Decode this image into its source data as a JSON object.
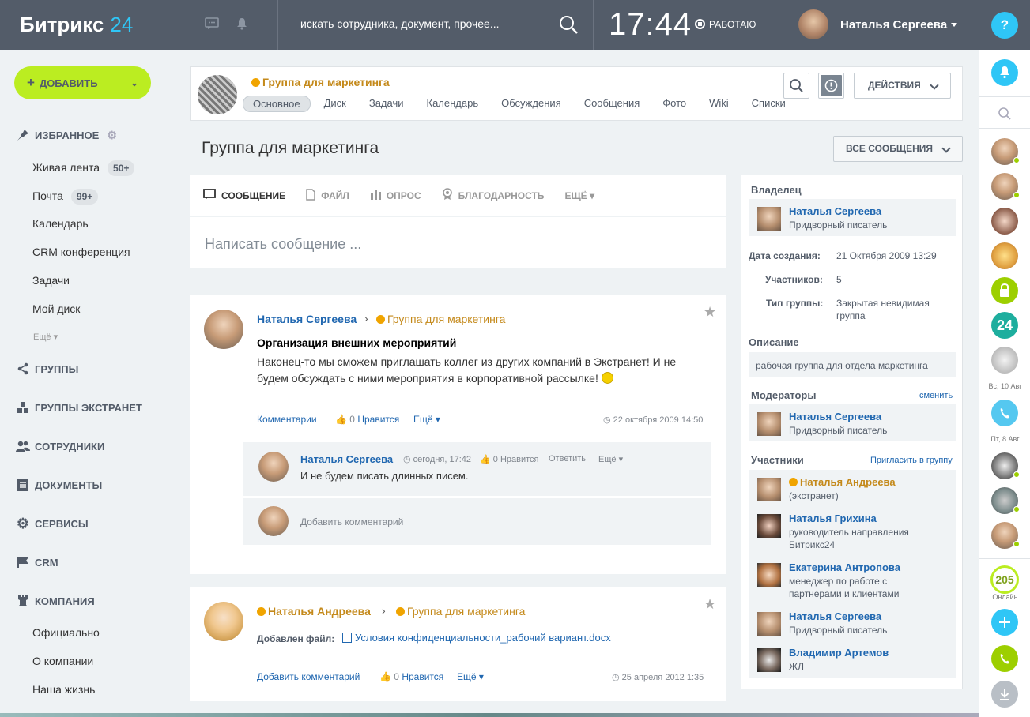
{
  "header": {
    "logo_main": "Битрикс",
    "logo_num": "24",
    "search_placeholder": "искать сотрудника, документ, прочее...",
    "time": "17:44",
    "work_status": "РАБОТАЮ",
    "user_name": "Наталья Сергеева"
  },
  "right_bar": {
    "help": "?",
    "label_day1": "Вс, 10 Авг",
    "label_day2": "Пт, 8 Авг",
    "online_count": "205",
    "online_label": "Онлайн",
    "b24": "24"
  },
  "left_menu": {
    "add_button": "ДОБАВИТЬ",
    "favorites": "ИЗБРАННОЕ",
    "items": [
      {
        "label": "Живая лента",
        "badge": "50+"
      },
      {
        "label": "Почта",
        "badge": "99+"
      },
      {
        "label": "Календарь"
      },
      {
        "label": "CRM конференция"
      },
      {
        "label": "Задачи"
      },
      {
        "label": "Мой диск"
      }
    ],
    "more": "Ещё",
    "sections": [
      "ГРУППЫ",
      "ГРУППЫ ЭКСТРАНЕТ",
      "СОТРУДНИКИ",
      "ДОКУМЕНТЫ",
      "СЕРВИСЫ",
      "CRM",
      "КОМПАНИЯ"
    ],
    "company_items": [
      "Официально",
      "О компании",
      "Наша жизнь"
    ]
  },
  "group": {
    "name": "Группа для маркетинга",
    "tabs": [
      "Основное",
      "Диск",
      "Задачи",
      "Календарь",
      "Обсуждения",
      "Сообщения",
      "Фото",
      "Wiki",
      "Списки"
    ],
    "actions": "ДЕЙСТВИЯ"
  },
  "page": {
    "title": "Группа для маркетинга",
    "all_messages": "ВСЕ СООБЩЕНИЯ"
  },
  "post_form": {
    "tabs": [
      "СООБЩЕНИЕ",
      "ФАЙЛ",
      "ОПРОС",
      "БЛАГОДАРНОСТЬ",
      "ЕЩЁ"
    ],
    "placeholder": "Написать сообщение ..."
  },
  "post1": {
    "author": "Наталья Сергеева",
    "group": "Группа для маркетинга",
    "title": "Организация внешних мероприятий",
    "text": "Наконец-то мы сможем приглашать коллег из других компаний в Экстранет! И не будем обсуждать с ними мероприятия в корпоративной рассылке!",
    "comments": "Комментарии",
    "likes": "0",
    "like_label": "Нравится",
    "more": "Ещё",
    "date": "22 октября 2009 14:50",
    "comment": {
      "author": "Наталья Сергеева",
      "time": "сегодня, 17:42",
      "likes": "0",
      "like_label": "Нравится",
      "reply": "Ответить",
      "more": "Ещё",
      "text": "И не будем писать длинных писем."
    },
    "add_comment": "Добавить комментарий"
  },
  "post2": {
    "author": "Наталья Андреева",
    "group": "Группа для маркетинга",
    "file_label": "Добавлен файл:",
    "file_name": "Условия конфиденциальности_рабочий вариант.docx",
    "add_comment": "Добавить комментарий",
    "likes": "0",
    "like_label": "Нравится",
    "more": "Ещё",
    "date": "25 апреля 2012 1:35"
  },
  "sidebar": {
    "owner_label": "Владелец",
    "owner": {
      "name": "Наталья Сергеева",
      "role": "Придворный писатель"
    },
    "created_label": "Дата создания:",
    "created": "21 Октября 2009 13:29",
    "members_count_label": "Участников:",
    "members_count": "5",
    "type_label": "Тип группы:",
    "type_line1": "Закрытая невидимая",
    "type_line2": "группа",
    "description_label": "Описание",
    "description": "рабочая группа для отдела маркетинга",
    "moderators_label": "Модераторы",
    "change": "сменить",
    "moderator": {
      "name": "Наталья Сергеева",
      "role": "Придворный писатель"
    },
    "members_label": "Участники",
    "invite": "Пригласить в группу",
    "members": [
      {
        "name": "Наталья Андреева",
        "role1": "(экстранет)",
        "role2": ""
      },
      {
        "name": "Наталья Грихина",
        "role1": "руководитель направления",
        "role2": "Битрикс24"
      },
      {
        "name": "Екатерина Антропова",
        "role1": "менеджер по работе с",
        "role2": "партнерами и клиентами"
      },
      {
        "name": "Наталья Сергеева",
        "role1": "Придворный писатель",
        "role2": ""
      },
      {
        "name": "Владимир Артемов",
        "role1": "ЖЛ",
        "role2": ""
      }
    ]
  },
  "colors": {
    "accent": "#2fc6f6",
    "add_button": "#bbed21",
    "header": "#535c69",
    "link": "#2067b0",
    "extranet": "#c4891a"
  }
}
